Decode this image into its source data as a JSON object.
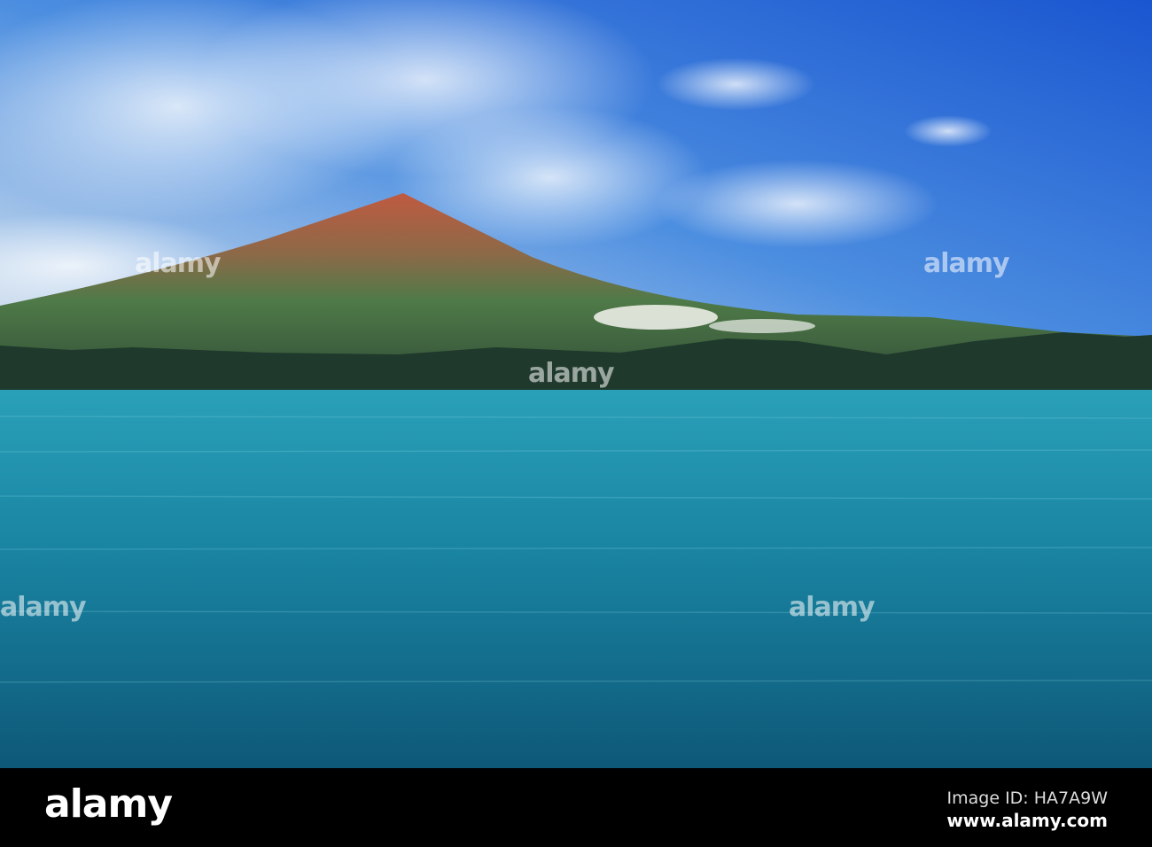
{
  "image": {
    "subject": "Mountain above lake",
    "colors": {
      "sky_top": "#1f5fd6",
      "sky_horizon": "#cfe3f2",
      "mountain_peak": "#b85a3e",
      "mountain_base": "#3e6a3c",
      "water": "#1a8aa6",
      "water_deep": "#0e5a7a"
    }
  },
  "watermark": {
    "text": "alamy"
  },
  "footer": {
    "logo": "alamy",
    "image_id": "Image ID: HA7A9W",
    "website": "www.alamy.com"
  }
}
